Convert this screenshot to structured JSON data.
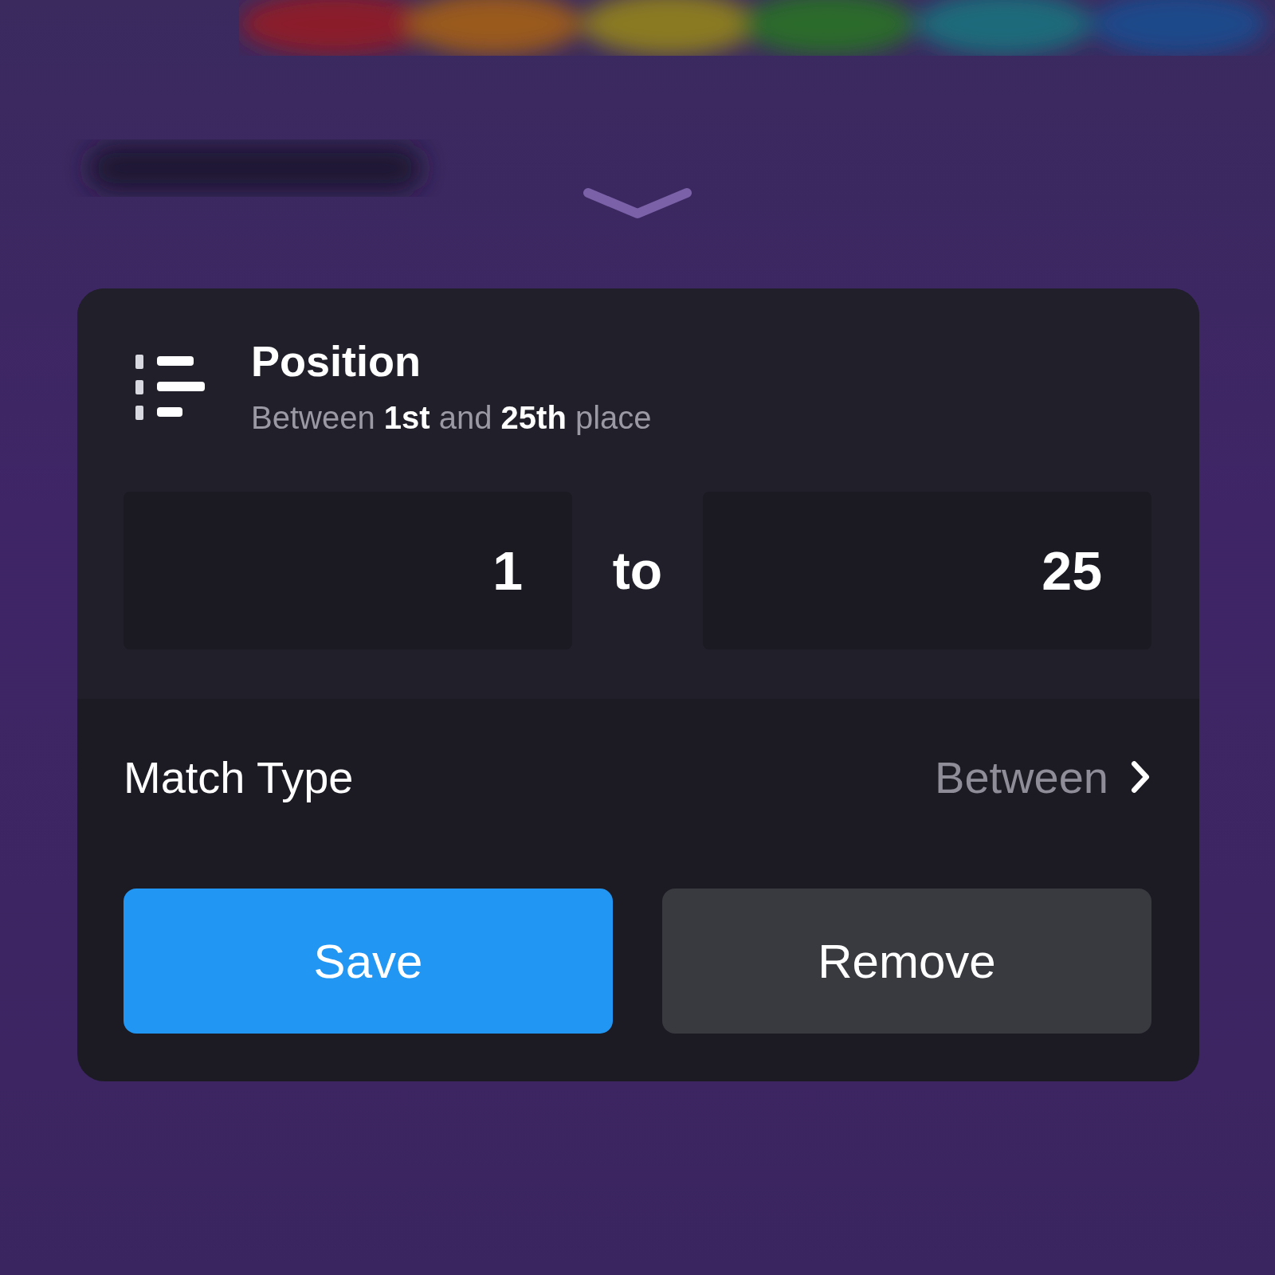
{
  "card": {
    "title": "Position",
    "subtitle": "Between **1st** and **25th** place",
    "range": {
      "from": "1",
      "separator": "to",
      "to": "25"
    },
    "match_type": {
      "label": "Match Type",
      "value": "Between"
    },
    "buttons": [
      {
        "label": "Save",
        "kind": "primary"
      },
      {
        "label": "Remove",
        "kind": "secondary"
      }
    ]
  }
}
